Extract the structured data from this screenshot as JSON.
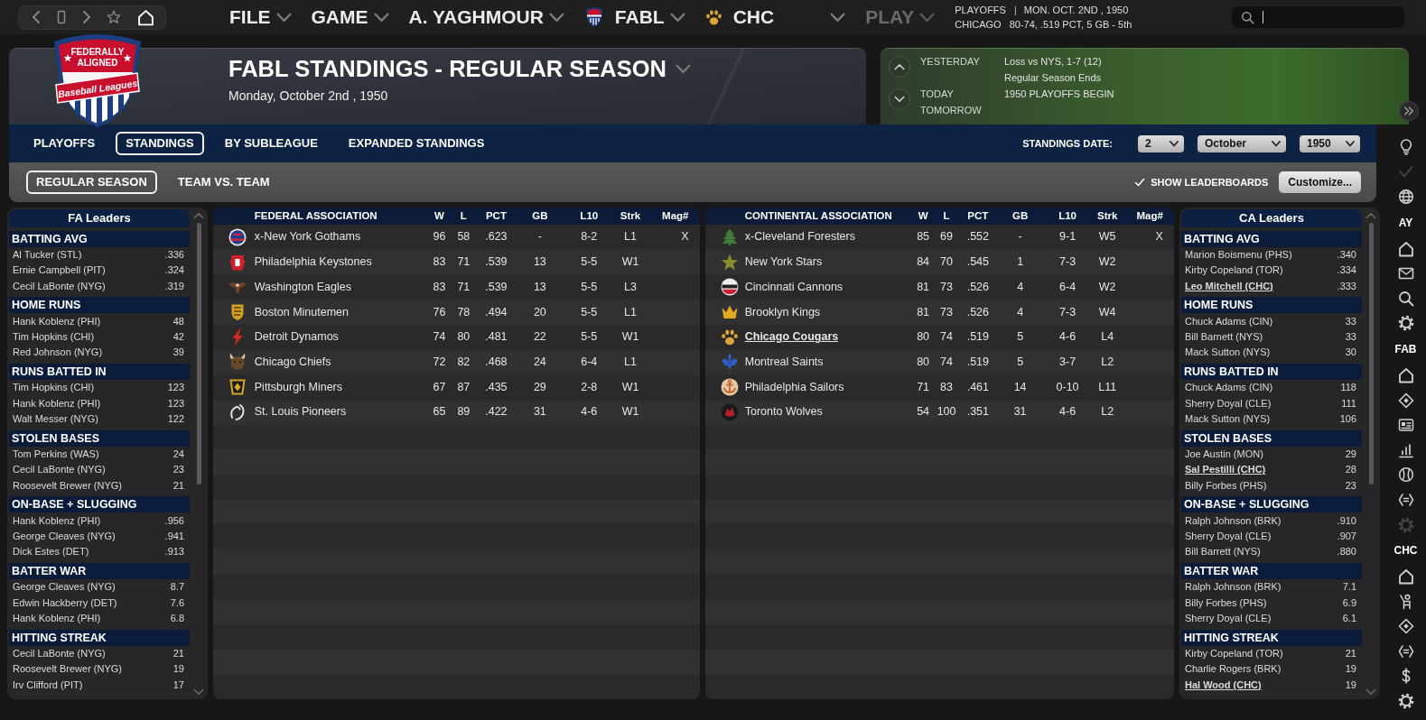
{
  "menu": [
    {
      "label": "FILE",
      "kind": "text",
      "disabled": false
    },
    {
      "label": "GAME",
      "kind": "text",
      "disabled": false
    },
    {
      "label": "A. YAGHMOUR",
      "kind": "text",
      "disabled": false
    },
    {
      "label": "FABL",
      "kind": "league",
      "disabled": false
    },
    {
      "label": "CHC",
      "kind": "team",
      "disabled": false
    },
    {
      "label": "PLAY",
      "kind": "text",
      "disabled": true
    }
  ],
  "status": [
    {
      "label": "PLAYOFFS",
      "separator": "|",
      "value": "MON. OCT. 2ND , 1950"
    },
    {
      "label": "CHICAGO",
      "value": "80-74, .519 PCT, 5 GB - 5th"
    }
  ],
  "search": {
    "focused": true
  },
  "logo": {
    "top_lines": [
      "FEDERALLY",
      "ALIGNED"
    ],
    "ribbon": "Baseball Leagues"
  },
  "page": {
    "title": "FABL STANDINGS - REGULAR SEASON",
    "date": "Monday, October 2nd , 1950"
  },
  "schedule": [
    {
      "label": "YESTERDAY",
      "lines": [
        "Loss vs NYS, 1-7 (12)",
        "Regular Season Ends"
      ]
    },
    {
      "label": "TODAY",
      "lines": [
        "1950 PLAYOFFS BEGIN"
      ]
    },
    {
      "label": "TOMORROW"
    }
  ],
  "tabs": [
    {
      "label": "PLAYOFFS",
      "selected": false
    },
    {
      "label": "STANDINGS",
      "selected": true
    },
    {
      "label": "BY SUBLEAGUE",
      "selected": false
    },
    {
      "label": "EXPANDED STANDINGS",
      "selected": false
    }
  ],
  "standings_date": {
    "label": "STANDINGS DATE:",
    "selects": [
      "2",
      "October",
      "1950"
    ]
  },
  "subtabs": [
    {
      "label": "REGULAR SEASON",
      "selected": true
    },
    {
      "label": "TEAM VS. TEAM",
      "selected": false
    }
  ],
  "show_leaderboards": {
    "label": "SHOW LEADERBOARDS",
    "checked": true
  },
  "customize_button": "Customize...",
  "fa_leaders": {
    "title": "FA Leaders",
    "categories": [
      {
        "title": "BATTING AVG",
        "rows": [
          {
            "player": "Al Tucker (STL)",
            "value": ".336",
            "user_team": false
          },
          {
            "player": "Ernie Campbell (PIT)",
            "value": ".324",
            "user_team": false
          },
          {
            "player": "Cecil LaBonte (NYG)",
            "value": ".319",
            "user_team": false
          }
        ]
      },
      {
        "title": "HOME RUNS",
        "rows": [
          {
            "player": "Hank Koblenz (PHI)",
            "value": "48",
            "user_team": false
          },
          {
            "player": "Tim Hopkins (CHI)",
            "value": "42",
            "user_team": false
          },
          {
            "player": "Red Johnson (NYG)",
            "value": "39",
            "user_team": false
          }
        ]
      },
      {
        "title": "RUNS BATTED IN",
        "rows": [
          {
            "player": "Tim Hopkins (CHI)",
            "value": "123",
            "user_team": false
          },
          {
            "player": "Hank Koblenz (PHI)",
            "value": "123",
            "user_team": false
          },
          {
            "player": "Walt Messer (NYG)",
            "value": "122",
            "user_team": false
          }
        ]
      },
      {
        "title": "STOLEN BASES",
        "rows": [
          {
            "player": "Tom Perkins (WAS)",
            "value": "24",
            "user_team": false
          },
          {
            "player": "Cecil LaBonte (NYG)",
            "value": "23",
            "user_team": false
          },
          {
            "player": "Roosevelt Brewer (NYG)",
            "value": "21",
            "user_team": false
          }
        ]
      },
      {
        "title": "ON-BASE + SLUGGING",
        "rows": [
          {
            "player": "Hank Koblenz (PHI)",
            "value": ".956",
            "user_team": false
          },
          {
            "player": "George Cleaves (NYG)",
            "value": ".941",
            "user_team": false
          },
          {
            "player": "Dick Estes (DET)",
            "value": ".913",
            "user_team": false
          }
        ]
      },
      {
        "title": "BATTER WAR",
        "rows": [
          {
            "player": "George Cleaves (NYG)",
            "value": "8.7",
            "user_team": false
          },
          {
            "player": "Edwin Hackberry (DET)",
            "value": "7.6",
            "user_team": false
          },
          {
            "player": "Hank Koblenz (PHI)",
            "value": "6.8",
            "user_team": false
          }
        ]
      },
      {
        "title": "HITTING STREAK",
        "rows": [
          {
            "player": "Cecil LaBonte (NYG)",
            "value": "21",
            "user_team": false
          },
          {
            "player": "Roosevelt Brewer (NYG)",
            "value": "19",
            "user_team": false
          },
          {
            "player": "Irv Clifford (PIT)",
            "value": "17",
            "user_team": false
          }
        ]
      }
    ]
  },
  "standings": [
    {
      "columns": [
        "FEDERAL ASSOCIATION",
        "W",
        "L",
        "PCT",
        "GB",
        "L10",
        "Strk",
        "Mag#"
      ],
      "rows": [
        {
          "cells": [
            "x-New York Gothams",
            "96",
            "58",
            ".623",
            "-",
            "8-2",
            "L1",
            "X"
          ],
          "user_team": false
        },
        {
          "cells": [
            "Philadelphia Keystones",
            "83",
            "71",
            ".539",
            "13",
            "5-5",
            "W1"
          ],
          "user_team": false
        },
        {
          "cells": [
            "Washington Eagles",
            "83",
            "71",
            ".539",
            "13",
            "5-5",
            "L3"
          ],
          "user_team": false
        },
        {
          "cells": [
            "Boston Minutemen",
            "76",
            "78",
            ".494",
            "20",
            "5-5",
            "L1"
          ],
          "user_team": false
        },
        {
          "cells": [
            "Detroit Dynamos",
            "74",
            "80",
            ".481",
            "22",
            "5-5",
            "W1"
          ],
          "user_team": false
        },
        {
          "cells": [
            "Chicago Chiefs",
            "72",
            "82",
            ".468",
            "24",
            "6-4",
            "L1"
          ],
          "user_team": false
        },
        {
          "cells": [
            "Pittsburgh Miners",
            "67",
            "87",
            ".435",
            "29",
            "2-8",
            "W1"
          ],
          "user_team": false
        },
        {
          "cells": [
            "St. Louis Pioneers",
            "65",
            "89",
            ".422",
            "31",
            "4-6",
            "W1"
          ],
          "user_team": false
        }
      ]
    },
    {
      "columns": [
        "CONTINENTAL ASSOCIATION",
        "W",
        "L",
        "PCT",
        "GB",
        "L10",
        "Strk",
        "Mag#"
      ],
      "rows": [
        {
          "cells": [
            "x-Cleveland Foresters",
            "85",
            "69",
            ".552",
            "-",
            "9-1",
            "W5",
            "X"
          ],
          "user_team": false
        },
        {
          "cells": [
            "New York Stars",
            "84",
            "70",
            ".545",
            "1",
            "7-3",
            "W2"
          ],
          "user_team": false
        },
        {
          "cells": [
            "Cincinnati Cannons",
            "81",
            "73",
            ".526",
            "4",
            "6-4",
            "W2"
          ],
          "user_team": false
        },
        {
          "cells": [
            "Brooklyn Kings",
            "81",
            "73",
            ".526",
            "4",
            "7-3",
            "W4"
          ],
          "user_team": false
        },
        {
          "cells": [
            "Chicago Cougars",
            "80",
            "74",
            ".519",
            "5",
            "4-6",
            "L4"
          ],
          "user_team": true
        },
        {
          "cells": [
            "Montreal Saints",
            "80",
            "74",
            ".519",
            "5",
            "3-7",
            "L2"
          ],
          "user_team": false
        },
        {
          "cells": [
            "Philadelphia Sailors",
            "71",
            "83",
            ".461",
            "14",
            "0-10",
            "L11"
          ],
          "user_team": false
        },
        {
          "cells": [
            "Toronto Wolves",
            "54",
            "100",
            ".351",
            "31",
            "4-6",
            "L2"
          ],
          "user_team": false
        }
      ]
    }
  ],
  "ca_leaders": {
    "title": "CA Leaders",
    "categories": [
      {
        "title": "BATTING AVG",
        "rows": [
          {
            "player": "Marion Boismenu (PHS)",
            "value": ".340",
            "user_team": false
          },
          {
            "player": "Kirby Copeland (TOR)",
            "value": ".334",
            "user_team": false
          },
          {
            "player": "Leo Mitchell (CHC)",
            "value": ".333",
            "user_team": true
          }
        ]
      },
      {
        "title": "HOME RUNS",
        "rows": [
          {
            "player": "Chuck Adams (CIN)",
            "value": "33",
            "user_team": false
          },
          {
            "player": "Bill Barnett (NYS)",
            "value": "33",
            "user_team": false
          },
          {
            "player": "Mack Sutton (NYS)",
            "value": "30",
            "user_team": false
          }
        ]
      },
      {
        "title": "RUNS BATTED IN",
        "rows": [
          {
            "player": "Chuck Adams (CIN)",
            "value": "118",
            "user_team": false
          },
          {
            "player": "Sherry Doyal (CLE)",
            "value": "111",
            "user_team": false
          },
          {
            "player": "Mack Sutton (NYS)",
            "value": "106",
            "user_team": false
          }
        ]
      },
      {
        "title": "STOLEN BASES",
        "rows": [
          {
            "player": "Joe Austin (MON)",
            "value": "29",
            "user_team": false
          },
          {
            "player": "Sal Pestilli (CHC)",
            "value": "28",
            "user_team": true
          },
          {
            "player": "Billy Forbes (PHS)",
            "value": "23",
            "user_team": false
          }
        ]
      },
      {
        "title": "ON-BASE + SLUGGING",
        "rows": [
          {
            "player": "Ralph Johnson (BRK)",
            "value": ".910",
            "user_team": false
          },
          {
            "player": "Sherry Doyal (CLE)",
            "value": ".907",
            "user_team": false
          },
          {
            "player": "Bill Barrett (NYS)",
            "value": ".880",
            "user_team": false
          }
        ]
      },
      {
        "title": "BATTER WAR",
        "rows": [
          {
            "player": "Ralph Johnson (BRK)",
            "value": "7.1",
            "user_team": false
          },
          {
            "player": "Billy Forbes (PHS)",
            "value": "6.9",
            "user_team": false
          },
          {
            "player": "Sherry Doyal (CLE)",
            "value": "6.1",
            "user_team": false
          }
        ]
      },
      {
        "title": "HITTING STREAK",
        "rows": [
          {
            "player": "Kirby Copeland (TOR)",
            "value": "21",
            "user_team": false
          },
          {
            "player": "Charlie Rogers (BRK)",
            "value": "19",
            "user_team": false
          },
          {
            "player": "Hal Wood (CHC)",
            "value": "19",
            "user_team": true
          }
        ]
      }
    ]
  },
  "sidebar": {
    "top": [
      {
        "disabled": false
      },
      {
        "disabled": true
      },
      {
        "disabled": false
      }
    ],
    "sections": [
      {
        "label": "AY",
        "buttons": [
          {
            "disabled": false
          },
          {
            "disabled": false
          },
          {
            "disabled": false
          },
          {
            "disabled": false
          }
        ]
      },
      {
        "label": "FAB",
        "buttons": [
          {
            "disabled": false
          },
          {
            "disabled": false
          },
          {
            "disabled": false
          },
          {
            "disabled": false
          },
          {
            "disabled": false
          },
          {
            "disabled": false
          },
          {
            "disabled": true
          }
        ]
      },
      {
        "label": "CHC",
        "buttons": [
          {
            "disabled": false
          },
          {
            "disabled": false
          },
          {
            "disabled": false
          },
          {
            "disabled": false
          },
          {
            "disabled": false
          },
          {
            "disabled": false
          }
        ]
      }
    ]
  }
}
